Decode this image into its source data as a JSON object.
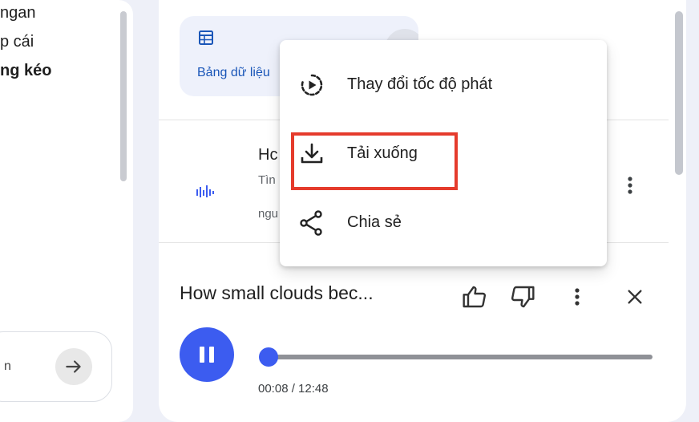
{
  "left_panel": {
    "lines": [
      "ngan",
      "p cái",
      "ng kéo"
    ],
    "input_partial": "n"
  },
  "table_card": {
    "label": "Bảng dữ liệu"
  },
  "audio_item": {
    "title": "Hc",
    "subtitle_1": "Tìn",
    "subtitle_2": "ngu"
  },
  "menu": {
    "items": [
      {
        "label": "Thay đổi tốc độ phát",
        "icon": "playback-speed-icon"
      },
      {
        "label": "Tải xuống",
        "icon": "download-icon"
      },
      {
        "label": "Chia sẻ",
        "icon": "share-icon"
      }
    ]
  },
  "player": {
    "title": "How small clouds bec...",
    "time": "00:08 / 12:48",
    "progress_fraction": 0.0107
  },
  "colors": {
    "accent": "#3c5cf0",
    "highlight": "#e53b2c",
    "link": "#1a56b8"
  }
}
